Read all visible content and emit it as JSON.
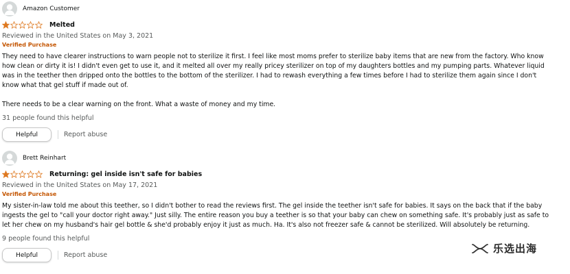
{
  "reviews": [
    {
      "author": "Amazon Customer",
      "rating": 1,
      "rating_max": 5,
      "title": "Melted",
      "date": "Reviewed in the United States on May 3, 2021",
      "verified": "Verified Purchase",
      "body": [
        "They need to have clearer instructions to warn people not to sterilize it first. I feel like most moms prefer to sterilize baby items that are new from the factory. Who know how clean or dirty it is! I didn't even get to use it, and it melted all over my really pricey sterilizer on top of my daughters bottles and my pumping parts. Whatever liquid was in the teether then dripped onto the bottles to the bottom of the sterilizer. I had to rewash everything a few times before I had to sterilize them again since I don't know what that gel stuff if made out of.",
        "There needs to be a clear warning on the front. What a waste of money and my time."
      ],
      "helpful_count": "31 people found this helpful",
      "helpful_label": "Helpful",
      "report_label": "Report abuse"
    },
    {
      "author": "Brett Reinhart",
      "rating": 1,
      "rating_max": 5,
      "title": "Returning: gel inside isn't safe for babies",
      "date": "Reviewed in the United States on May 17, 2021",
      "verified": "Verified Purchase",
      "body": [
        "My sister-in-law told me about this teether, so I didn't bother to read the reviews first. The gel inside the teether isn't safe for babies. It says on the back that if the baby ingests the gel to \"call your doctor right away.\" Just silly. The entire reason you buy a teether is so that your baby can chew on something safe. It's probably just as safe to let her chew on my husband's hair gel bottle & she'd probably enjoy it just as much. Ha. It's also not freezer safe & cannot be sterilized. Will absolutely be returning."
      ],
      "helpful_count": "9 people found this helpful",
      "helpful_label": "Helpful",
      "report_label": "Report abuse"
    }
  ],
  "watermark": {
    "text": "乐选出海",
    "icon": "wechat-channel-icon"
  },
  "colors": {
    "star_filled": "#de7921",
    "star_empty": "#de7921",
    "verified": "#c45500",
    "muted": "#565959",
    "avatar_bg": "#d5d9d9"
  },
  "icons": {
    "avatar": "default-user-avatar-icon",
    "star": "star-icon"
  }
}
